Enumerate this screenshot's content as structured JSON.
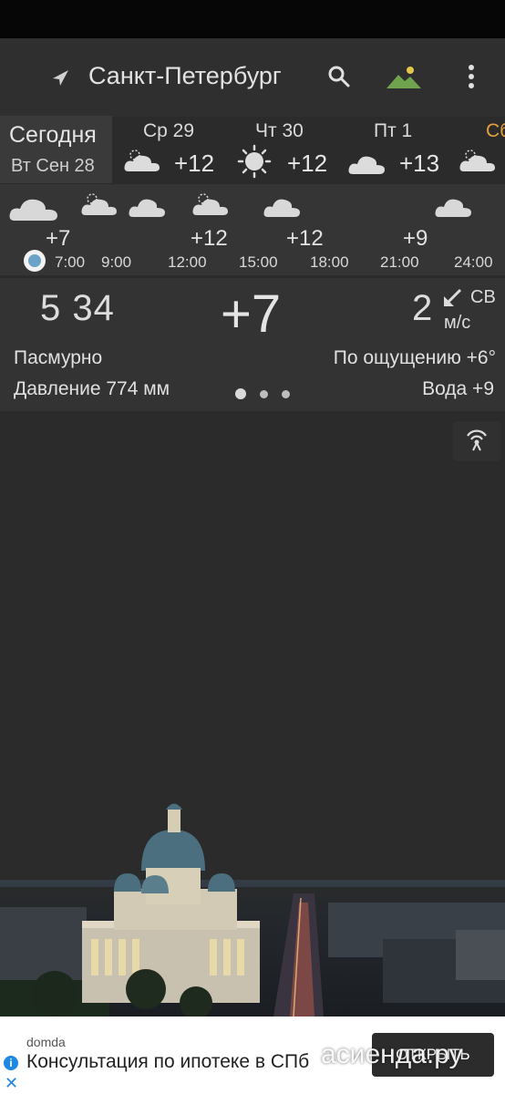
{
  "header": {
    "city": "Санкт-Петербург"
  },
  "days": {
    "today_title": "Сегодня",
    "today_date": "Вт Сен 28",
    "items": [
      {
        "label": "Ср 29",
        "temp": "+12",
        "icon": "cloud-sun-icon"
      },
      {
        "label": "Чт 30",
        "temp": "+12",
        "icon": "sun-icon"
      },
      {
        "label": "Пт 1",
        "temp": "+13",
        "icon": "cloud-icon"
      },
      {
        "label": "Сб",
        "temp": "",
        "icon": "cloud-icon"
      }
    ]
  },
  "hourly": {
    "temps": [
      "+7",
      "+12",
      "+12",
      "+9"
    ],
    "times": [
      "7:00",
      "9:00",
      "12:00",
      "15:00",
      "18:00",
      "21:00",
      "24:00"
    ]
  },
  "current": {
    "sunrise": "5 34",
    "temp": "+7",
    "wind_speed": "2",
    "wind_dir": "СВ",
    "wind_unit": "м/с",
    "condition": "Пасмурно",
    "feels": "По ощущению +6°",
    "pressure": "Давление 774 мм",
    "water": "Вода +9"
  },
  "ad": {
    "source": "domda",
    "text": "Консультация по ипотеке в СПб",
    "open_label": "ОТКРЫТЬ",
    "info_glyph": "i",
    "close_glyph": "✕"
  },
  "watermark": "асиенда.ру",
  "colors": {
    "accent_weekend": "#e0a13c",
    "now_dot": "#6aa3c7"
  }
}
